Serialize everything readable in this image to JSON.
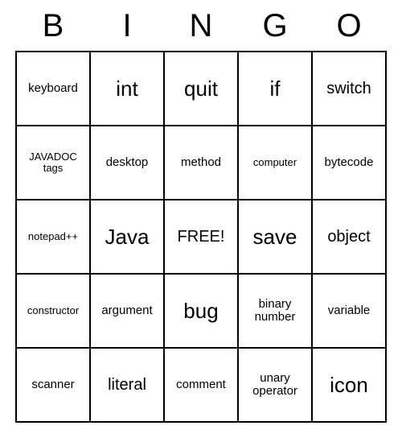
{
  "header": [
    "B",
    "I",
    "N",
    "G",
    "O"
  ],
  "cells": [
    {
      "text": "keyboard",
      "size": "small"
    },
    {
      "text": "int",
      "size": "large"
    },
    {
      "text": "quit",
      "size": "large"
    },
    {
      "text": "if",
      "size": "large"
    },
    {
      "text": "switch",
      "size": "medium"
    },
    {
      "text": "JAVADOC tags",
      "size": "xsmall"
    },
    {
      "text": "desktop",
      "size": "small"
    },
    {
      "text": "method",
      "size": "small"
    },
    {
      "text": "computer",
      "size": "xsmall"
    },
    {
      "text": "bytecode",
      "size": "small"
    },
    {
      "text": "notepad++",
      "size": "xsmall"
    },
    {
      "text": "Java",
      "size": "large"
    },
    {
      "text": "FREE!",
      "size": "medium"
    },
    {
      "text": "save",
      "size": "large"
    },
    {
      "text": "object",
      "size": "medium"
    },
    {
      "text": "constructor",
      "size": "xsmall"
    },
    {
      "text": "argument",
      "size": "small"
    },
    {
      "text": "bug",
      "size": "large"
    },
    {
      "text": "binary number",
      "size": "small"
    },
    {
      "text": "variable",
      "size": "small"
    },
    {
      "text": "scanner",
      "size": "small"
    },
    {
      "text": "literal",
      "size": "medium"
    },
    {
      "text": "comment",
      "size": "small"
    },
    {
      "text": "unary operator",
      "size": "small"
    },
    {
      "text": "icon",
      "size": "large"
    }
  ]
}
